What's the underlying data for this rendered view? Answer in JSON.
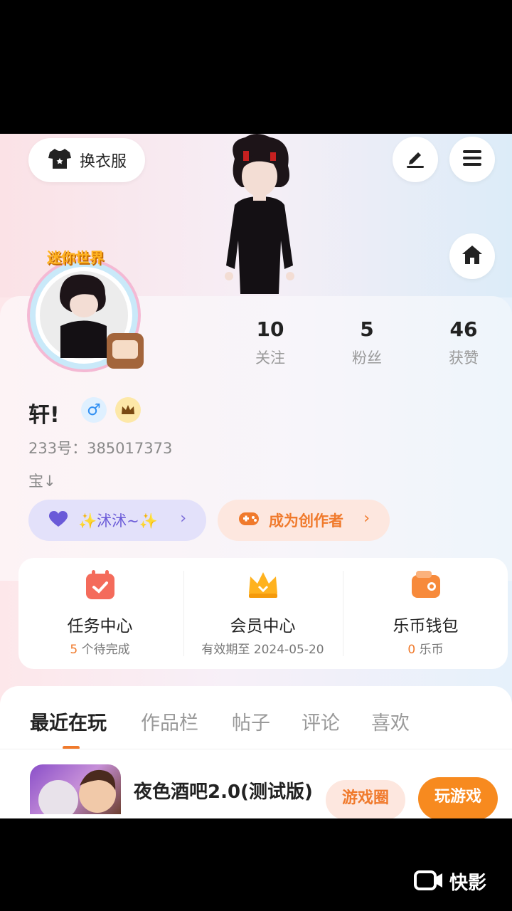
{
  "header": {
    "outfit_label": "换衣服"
  },
  "profile": {
    "username": "轩!",
    "gender_symbol": "♂",
    "uid": "233号：385017373",
    "bio": "宝↓",
    "badge_text": "迷你世界"
  },
  "stats": [
    {
      "value": "10",
      "label": "关注"
    },
    {
      "value": "5",
      "label": "粉丝"
    },
    {
      "value": "46",
      "label": "获赞"
    }
  ],
  "tags": {
    "fan_club": "✨沭沭~✨",
    "creator": "成为创作者",
    "chevron": "›"
  },
  "quick": [
    {
      "title": "任务中心",
      "count": "5",
      "sub": " 个待完成"
    },
    {
      "title": "会员中心",
      "sub": "有效期至 2024-05-20"
    },
    {
      "title": "乐币钱包",
      "count": "0",
      "sub": " 乐币"
    }
  ],
  "tabs": [
    "最近在玩",
    "作品栏",
    "帖子",
    "评论",
    "喜欢"
  ],
  "game": {
    "title": "夜色酒吧2.0(测试版)",
    "circle_label": "游戏圈",
    "play_label": "玩游戏"
  },
  "watermark": "快影",
  "colors": {
    "accent": "#f07a2c",
    "purple": "#6a5ad8",
    "play": "#f78a1f"
  }
}
